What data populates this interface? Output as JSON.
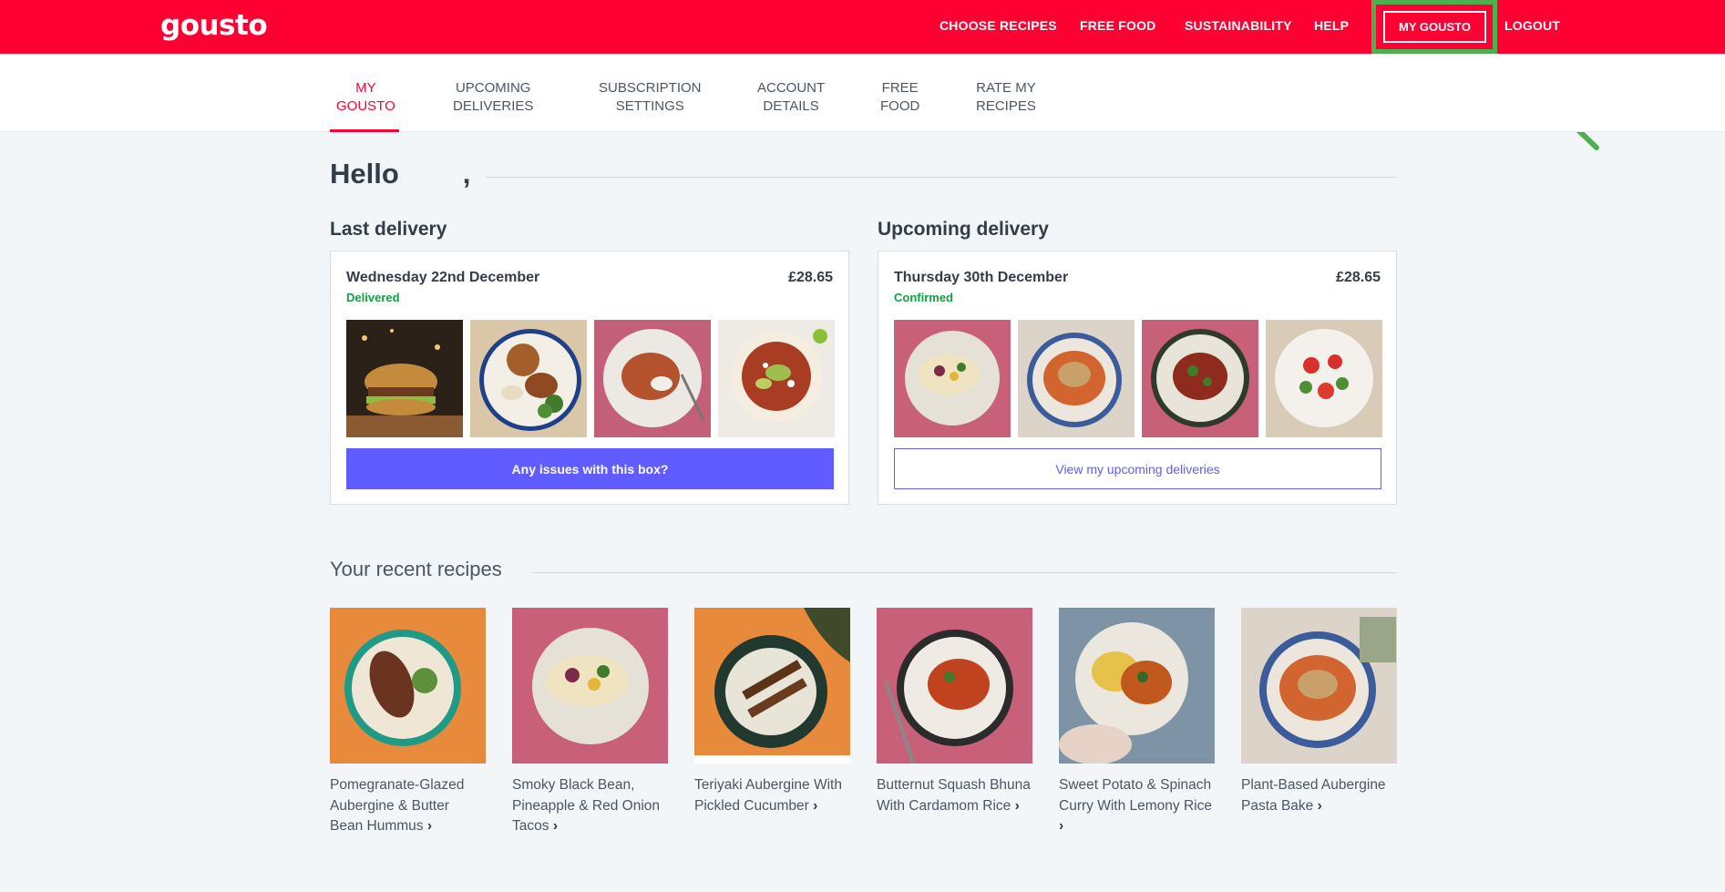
{
  "header": {
    "logo": "gousto",
    "nav": [
      "CHOOSE RECIPES",
      "FREE FOOD",
      "SUSTAINABILITY",
      "HELP"
    ],
    "my_gousto": "MY GOUSTO",
    "logout": "LOGOUT",
    "brand_color": "#ff0032",
    "highlight_color": "#4caf50"
  },
  "subnav": [
    {
      "line1": "MY",
      "line2": "GOUSTO"
    },
    {
      "line1": "UPCOMING",
      "line2": "DELIVERIES"
    },
    {
      "line1": "SUBSCRIPTION",
      "line2": "SETTINGS"
    },
    {
      "line1": "ACCOUNT",
      "line2": "DETAILS"
    },
    {
      "line1": "FREE",
      "line2": "FOOD"
    },
    {
      "line1": "RATE MY",
      "line2": "RECIPES"
    }
  ],
  "greeting": {
    "hello": "Hello",
    "comma": ","
  },
  "last_delivery": {
    "title": "Last delivery",
    "date": "Wednesday 22nd December",
    "price": "£28.65",
    "status": "Delivered",
    "button": "Any issues with this box?"
  },
  "upcoming_delivery": {
    "title": "Upcoming delivery",
    "date": "Thursday 30th December",
    "price": "£28.65",
    "status": "Confirmed",
    "button": "View my upcoming deliveries"
  },
  "recent": {
    "title": "Your recent recipes",
    "recipes": [
      "Pomegranate-Glazed Aubergine & Butter Bean Hummus",
      "Smoky Black Bean, Pineapple & Red Onion Tacos",
      "Teriyaki Aubergine With Pickled Cucumber",
      "Butternut Squash Bhuna With Cardamom Rice",
      "Sweet Potato & Spinach Curry With Lemony Rice",
      "Plant-Based Aubergine Pasta Bake"
    ]
  },
  "icons": {
    "chevron": "chevron-right-icon",
    "arrow": "pointer-arrow-icon"
  }
}
